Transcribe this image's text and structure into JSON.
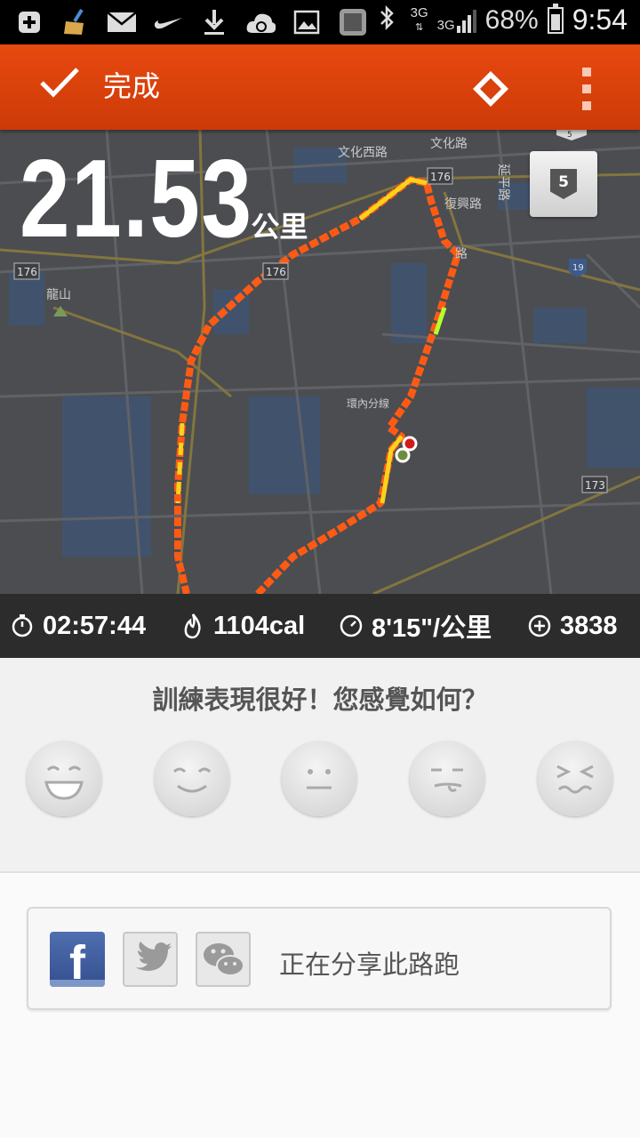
{
  "status_bar": {
    "network_top": "3G",
    "network_second": "3G",
    "battery_percent": "68%",
    "time": "9:54",
    "battery_level": 0.68,
    "icons": [
      "add-notification-icon",
      "cleaner-broom-icon",
      "mail-icon",
      "nike-swoosh-icon",
      "download-icon",
      "cloud-sync-icon",
      "image-icon",
      "app-icon",
      "bluetooth-icon"
    ]
  },
  "action_bar": {
    "done_label": "完成",
    "color": "#d9420b"
  },
  "map": {
    "distance_value": "21.53",
    "distance_unit": "公里",
    "lap_badge": "5",
    "labels": {
      "road_wenhua_west": "文化西路",
      "road_wenhua": "文化路",
      "road_fuxing": "復興路",
      "road_yanping": "延平路",
      "road_partial_lu": "路",
      "road_huannei": "環內分線",
      "place_longshan": "龍山",
      "route_176_a": "176",
      "route_176_b": "176",
      "route_176_c": "176",
      "route_19": "19",
      "route_173": "173",
      "route_5": "5"
    }
  },
  "stats": {
    "duration": "02:57:44",
    "calories": "1104cal",
    "pace": "8'15\"/公里",
    "fuel": "3838"
  },
  "feedback": {
    "prompt": "訓練表現很好！您感覺如何？",
    "faces": [
      "very-happy-face-icon",
      "happy-face-icon",
      "neutral-face-icon",
      "meh-face-icon",
      "unhappy-face-icon"
    ]
  },
  "share": {
    "label": "正在分享此路跑",
    "services": [
      "facebook-icon",
      "twitter-icon",
      "wechat-icon"
    ]
  }
}
